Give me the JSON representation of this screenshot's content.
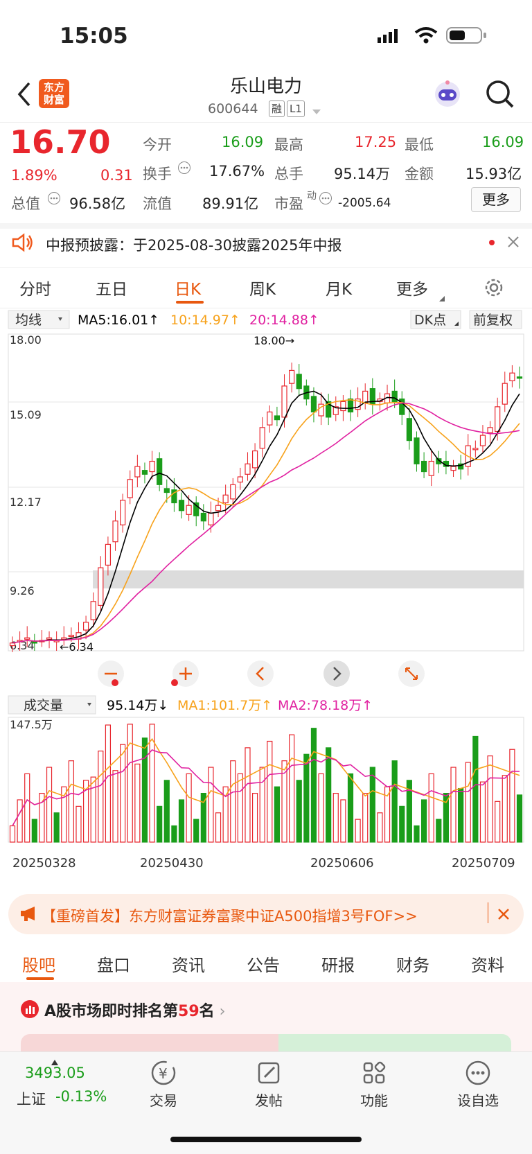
{
  "status": {
    "time": "15:05"
  },
  "header": {
    "title": "乐山电力",
    "code": "600644",
    "tag1": "融",
    "tag2": "L1",
    "logo": "东方\n财富"
  },
  "quote": {
    "price": "16.70",
    "pct": "1.89%",
    "chg": "0.31",
    "open_label": "今开",
    "open": "16.09",
    "high_label": "最高",
    "high": "17.25",
    "low_label": "最低",
    "low": "16.09",
    "turnover_label": "换手",
    "turnover": "17.67%",
    "vol_label": "总手",
    "vol": "95.14万",
    "amt_label": "金额",
    "amt": "15.93亿",
    "mcap_label": "总值",
    "mcap": "96.58亿",
    "float_label": "流值",
    "float": "89.91亿",
    "pe_label": "市盈",
    "pe_sup": "动",
    "pe": "-2005.64",
    "more": "更多"
  },
  "notice": {
    "text": "中报预披露：于2025-08-30披露2025年中报"
  },
  "tabs": [
    "分时",
    "五日",
    "日K",
    "周K",
    "月K",
    "更多"
  ],
  "chart_data": {
    "type": "candlestick",
    "ma_label": "均线",
    "ma5": "MA5:16.01↑",
    "ma10": "10:14.97↑",
    "ma20": "20:14.88↑",
    "dk": "DK点",
    "fq": "前复权",
    "y_ticks": [
      "18.00",
      "15.09",
      "12.17",
      "9.26",
      "6.34"
    ],
    "max_label": "18.00→",
    "min_label": "←6.34",
    "vol_label": "成交量",
    "vol_val": "95.14万↓",
    "vma1": "MA1:101.7万↑",
    "vma2": "MA2:78.18万↑",
    "vol_max": "147.5万",
    "dates": [
      "20250328",
      "20250430",
      "20250606",
      "20250709"
    ],
    "colors": {
      "up": "#e8262d",
      "down": "#1a9d1a",
      "ma5": "#000000",
      "ma10": "#f7a21b",
      "ma20": "#e020a0"
    }
  },
  "ad": {
    "text": "【重磅首发】东方财富证券富聚中证A500指增3号FOF>>"
  },
  "bottom_tabs": [
    "股吧",
    "盘口",
    "资讯",
    "公告",
    "研报",
    "财务",
    "资料"
  ],
  "rank": {
    "prefix": "A股市场即时排名第",
    "num": "59",
    "suffix": "名"
  },
  "nav": {
    "index_val": "3493.05",
    "index_name": "上证",
    "index_pct": "-0.13%",
    "items": [
      "交易",
      "发帖",
      "功能",
      "设自选"
    ]
  }
}
